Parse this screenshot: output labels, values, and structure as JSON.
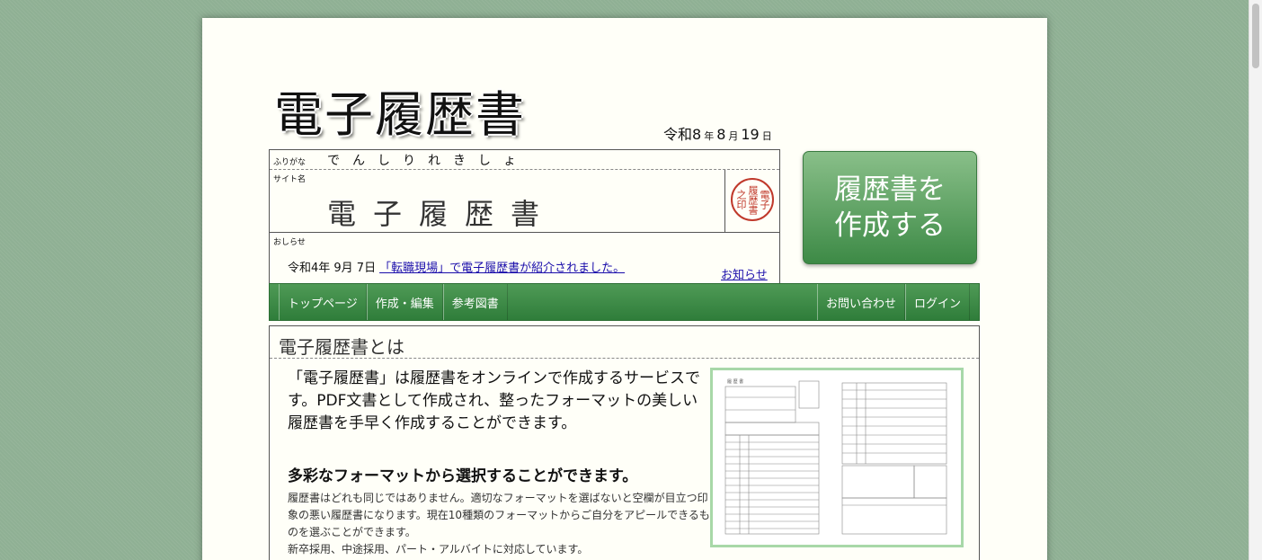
{
  "header": {
    "logo": "電子履歴書",
    "date": {
      "era": "令和8",
      "year_unit": "年",
      "month": "8",
      "month_unit": "月",
      "day": "19",
      "day_unit": "日"
    }
  },
  "resume_card": {
    "furigana_label": "ふりがな",
    "furigana": "でんしりれきしょ",
    "name_label": "サイト名",
    "name": "電子履歴書",
    "seal_text": [
      "電子",
      "履歴書",
      "之印"
    ],
    "news_label": "おしらせ",
    "news_date": "令和4年 9月 7日",
    "news_link": "「転職現場」で電子履歴書が紹介されました。",
    "news_more": "お知らせ"
  },
  "create_button": {
    "label": "履歴書を\n作成する"
  },
  "nav": {
    "left": [
      "トップページ",
      "作成・編集",
      "参考図書"
    ],
    "right": [
      "お問い合わせ",
      "ログイン"
    ]
  },
  "intro": {
    "title": "電子履歴書とは",
    "lead": "「電子履歴書」は履歴書をオンラインで作成するサービスです。PDF文書として作成され、整ったフォーマットの美しい履歴書を手早く作成することができます。",
    "feature_heading": "多彩なフォーマットから選択することができます。",
    "feature_body": "履歴書はどれも同じではありません。適切なフォーマットを選ばないと空欄が目立つ印象の悪い履歴書になります。現在10種類のフォーマットからご自分をアピールできるものを選ぶことができます。",
    "feature_body2": "新卒採用、中途採用、パート・アルバイトに対応しています。",
    "preview_caption": "履 歴 書"
  },
  "colors": {
    "background": "#8fb094",
    "nav_green": "#3d8a46",
    "seal_red": "#c0392b",
    "link": "#1a0dab"
  }
}
